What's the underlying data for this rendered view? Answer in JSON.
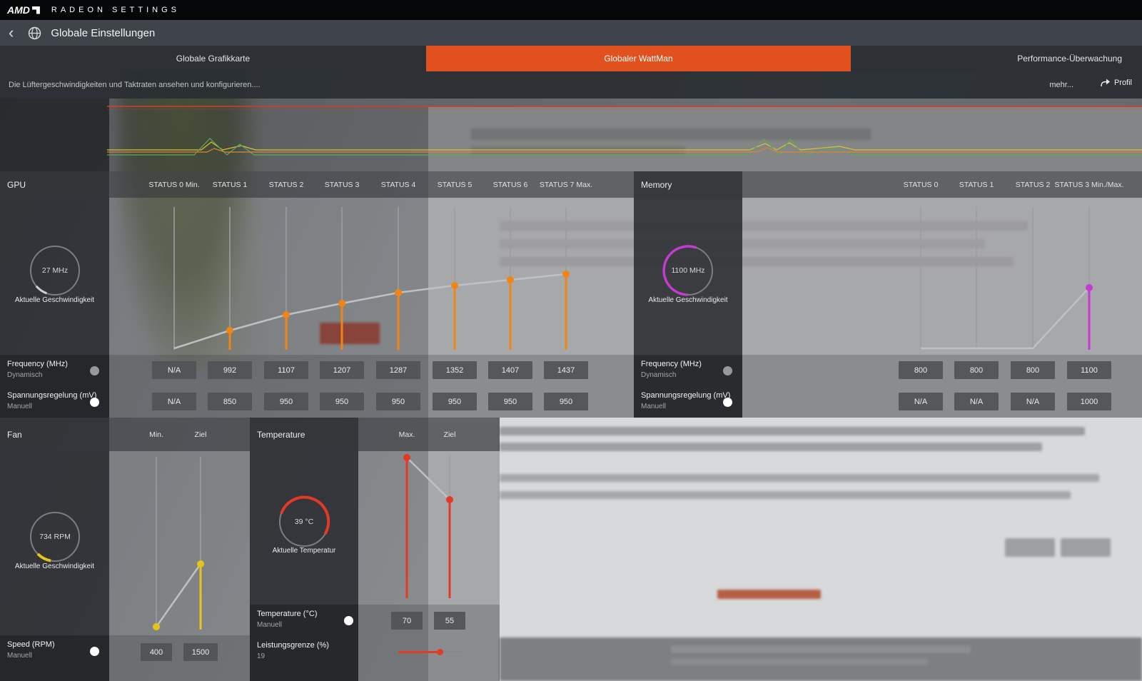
{
  "titlebar": {
    "brand": "AMD",
    "app_title": "RADEON SETTINGS"
  },
  "header": {
    "title": "Globale Einstellungen"
  },
  "tabs": {
    "graphics": "Globale Grafikkarte",
    "wattman": "Globaler WattMan",
    "performance": "Performance-Überwachung"
  },
  "subheader": {
    "description": "Die Lüftergeschwindigkeiten und Taktraten ansehen und konfigurieren....",
    "more": "mehr...",
    "profile": "Profil"
  },
  "gpu": {
    "label": "GPU",
    "statuses": [
      "STATUS 0 Min.",
      "STATUS 1",
      "STATUS 2",
      "STATUS 3",
      "STATUS 4",
      "STATUS 5",
      "STATUS 6",
      "STATUS 7 Max."
    ],
    "gauge": {
      "value": "27 MHz",
      "caption": "Aktuelle Geschwindigkeit"
    },
    "frequency": {
      "label": "Frequency (MHz)",
      "mode": "Dynamisch",
      "values": [
        "N/A",
        "992",
        "1107",
        "1207",
        "1287",
        "1352",
        "1407",
        "1437"
      ]
    },
    "voltage": {
      "label": "Spannungsregelung (mV)",
      "mode": "Manuell",
      "values": [
        "N/A",
        "850",
        "950",
        "950",
        "950",
        "950",
        "950",
        "950"
      ]
    }
  },
  "memory": {
    "label": "Memory",
    "statuses": [
      "STATUS 0",
      "STATUS 1",
      "STATUS 2",
      "STATUS 3 Min./Max."
    ],
    "gauge": {
      "value": "1100 MHz",
      "caption": "Aktuelle Geschwindigkeit"
    },
    "frequency": {
      "label": "Frequency (MHz)",
      "mode": "Dynamisch",
      "values": [
        "800",
        "800",
        "800",
        "1100"
      ]
    },
    "voltage": {
      "label": "Spannungsregelung (mV)",
      "mode": "Manuell",
      "values": [
        "N/A",
        "N/A",
        "N/A",
        "1000"
      ]
    }
  },
  "fan": {
    "label": "Fan",
    "columns": [
      "Min.",
      "Ziel"
    ],
    "gauge": {
      "value": "734 RPM",
      "caption": "Aktuelle Geschwindigkeit"
    },
    "speed": {
      "label": "Speed (RPM)",
      "mode": "Manuell",
      "values": [
        "400",
        "1500"
      ]
    }
  },
  "temperature": {
    "label": "Temperature",
    "columns": [
      "Max.",
      "Ziel"
    ],
    "gauge": {
      "value": "39 °C",
      "caption": "Aktuelle Temperatur"
    },
    "temp": {
      "label": "Temperature (°C)",
      "mode": "Manuell",
      "values": [
        "70",
        "55"
      ]
    },
    "power": {
      "label": "Leistungsgrenze (%)",
      "value": "19"
    }
  },
  "colors": {
    "accent": "#e0511e",
    "gpu_dot": "#f08414",
    "memory_dot": "#c43bd1",
    "fan_dot": "#e7c31c",
    "temp_dot": "#e23a25"
  }
}
